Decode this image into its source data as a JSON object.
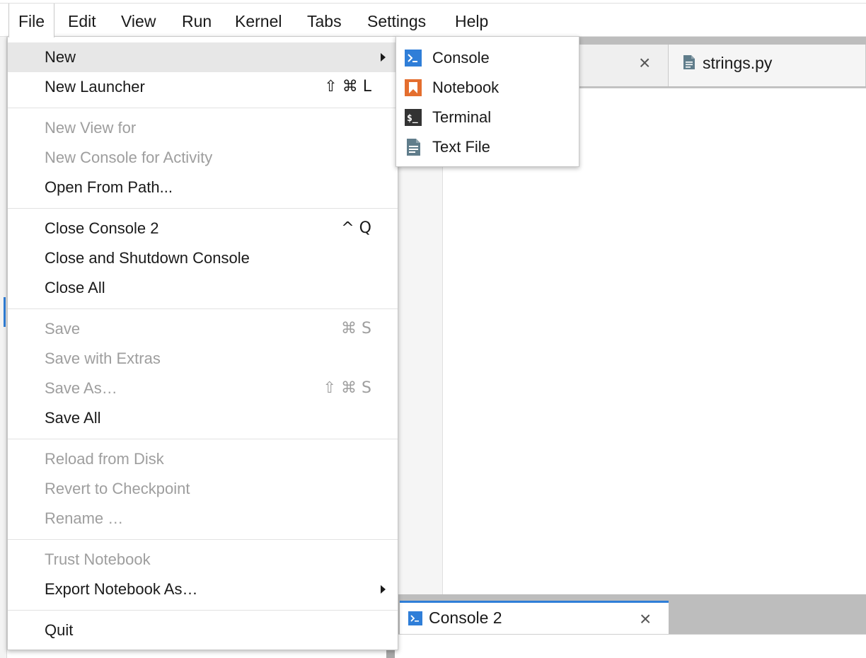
{
  "menubar": {
    "items": [
      "File",
      "Edit",
      "View",
      "Run",
      "Kernel",
      "Tabs",
      "Settings",
      "Help"
    ],
    "active": "File"
  },
  "file_menu": {
    "new": {
      "label": "New",
      "has_submenu": true
    },
    "new_launcher": {
      "label": "New Launcher",
      "shortcut": "⇧ ⌘ L"
    },
    "new_view_for": {
      "label": "New View for",
      "disabled": true
    },
    "new_console_for_activity": {
      "label": "New Console for Activity",
      "disabled": true
    },
    "open_from_path": {
      "label": "Open From Path..."
    },
    "close_console": {
      "label": "Close Console 2",
      "shortcut": "^ Q"
    },
    "close_and_shutdown": {
      "label": "Close and Shutdown Console"
    },
    "close_all": {
      "label": "Close All"
    },
    "save": {
      "label": "Save",
      "shortcut": "⌘ S",
      "disabled": true
    },
    "save_with_extras": {
      "label": "Save with Extras",
      "disabled": true
    },
    "save_as": {
      "label": "Save As…",
      "shortcut": "⇧ ⌘ S",
      "disabled": true
    },
    "save_all": {
      "label": "Save All"
    },
    "reload_from_disk": {
      "label": "Reload from Disk",
      "disabled": true
    },
    "revert_to_checkpoint": {
      "label": "Revert to Checkpoint",
      "disabled": true
    },
    "rename": {
      "label": "Rename …",
      "disabled": true
    },
    "trust_notebook": {
      "label": "Trust Notebook",
      "disabled": true
    },
    "export_notebook_as": {
      "label": "Export Notebook As…",
      "has_submenu": true
    },
    "quit": {
      "label": "Quit"
    }
  },
  "new_submenu": {
    "items": [
      {
        "label": "Console",
        "icon": "console-icon",
        "color": "#2f7ed8"
      },
      {
        "label": "Notebook",
        "icon": "notebook-icon",
        "color": "#e46e2e"
      },
      {
        "label": "Terminal",
        "icon": "terminal-icon",
        "color": "#333333"
      },
      {
        "label": "Text File",
        "icon": "text-file-icon",
        "color": "#607d8b"
      }
    ]
  },
  "tabs": {
    "top": {
      "strings_label": "strings.py"
    },
    "bottom": {
      "console_label": "Console 2"
    }
  },
  "colors": {
    "accent": "#2f7ed8",
    "disabled_text": "#9e9e9e",
    "highlight": "#e7e7e7"
  }
}
